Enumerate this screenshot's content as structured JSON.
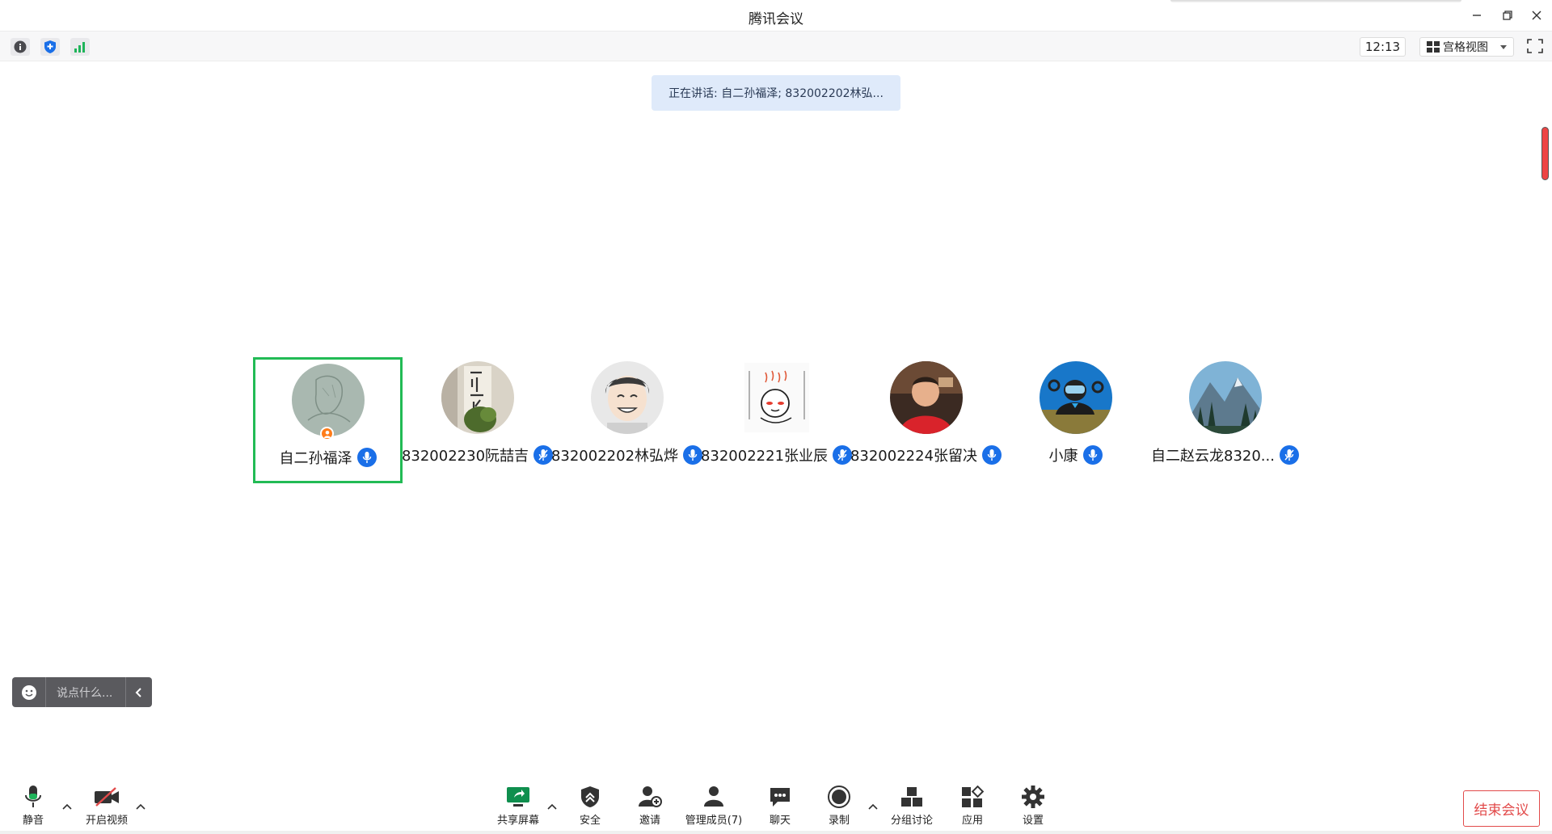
{
  "window": {
    "title": "腾讯会议"
  },
  "infobar": {
    "clock": "12:13",
    "view_mode": "宫格视图"
  },
  "speaking_banner": "正在讲话: 自二孙福泽; 832002202林弘...",
  "participants": [
    {
      "name": "自二孙福泽",
      "is_host": true,
      "active": true,
      "avatar": "sketch"
    },
    {
      "name": "832002230阮喆吉",
      "is_host": false,
      "active": false,
      "avatar": "calligraphy"
    },
    {
      "name": "832002202林弘烨",
      "is_host": false,
      "active": false,
      "avatar": "anime-boy"
    },
    {
      "name": "832002221张业辰",
      "is_host": false,
      "active": false,
      "avatar": "sticker"
    },
    {
      "name": "832002224张留决",
      "is_host": false,
      "active": false,
      "avatar": "red-shirt"
    },
    {
      "name": "小康",
      "is_host": false,
      "active": false,
      "avatar": "diver"
    },
    {
      "name": "自二赵云龙8320...",
      "is_host": false,
      "active": false,
      "avatar": "mountain"
    }
  ],
  "chat": {
    "placeholder": "说点什么..."
  },
  "toolbar": {
    "mute": "静音",
    "video": "开启视频",
    "share": "共享屏幕",
    "security": "安全",
    "invite": "邀请",
    "members": "管理成员(7)",
    "chat": "聊天",
    "record": "录制",
    "breakout": "分组讨论",
    "apps": "应用",
    "settings": "设置",
    "end": "结束会议"
  },
  "colors": {
    "active_border": "#22bb55",
    "mic_badge": "#1a6fe8",
    "end_button": "#e24a4a",
    "speaking_banner": "#dfeafa"
  }
}
